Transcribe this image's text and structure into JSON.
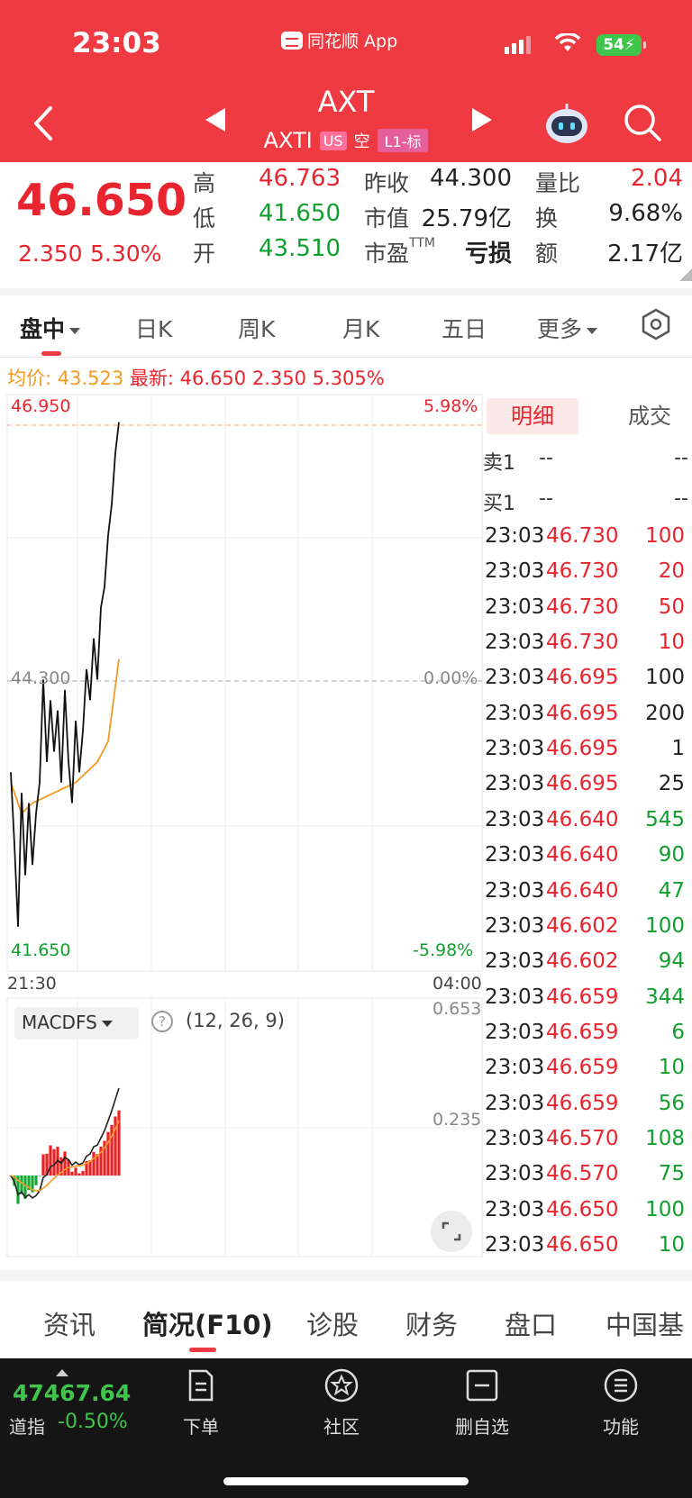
{
  "status": {
    "time": "23:03",
    "app_label": "同花顺 App",
    "battery": "54"
  },
  "header": {
    "symbol": "AXT",
    "sub_symbol": "AXTI",
    "tag_us": "US",
    "tag_short": "空",
    "tag_level": "L1-标"
  },
  "quote": {
    "price": "46.650",
    "change": "2.350",
    "change_pct": "5.30%",
    "rows": [
      {
        "l1": "高",
        "v1": "46.763",
        "l2": "昨收",
        "v2": "44.300",
        "l3": "量比",
        "v3": "2.04"
      },
      {
        "l1": "低",
        "v1": "41.650",
        "l2": "市值",
        "v2": "25.79亿",
        "l3": "换",
        "v3": "9.68%"
      },
      {
        "l1": "开",
        "v1": "43.510",
        "l2": "市盈",
        "l2_sup": "TTM",
        "v2": "亏损",
        "l3": "额",
        "v3": "2.17亿"
      }
    ]
  },
  "tabs": [
    "盘中",
    "日K",
    "周K",
    "月K",
    "五日",
    "更多"
  ],
  "infoline": {
    "avg_label": "均价: 43.523",
    "latest_label": "最新: 46.650",
    "change": "2.350",
    "pct": "5.305%"
  },
  "axis": {
    "top_price": "46.950",
    "top_pct": "5.98%",
    "mid_price": "44.300",
    "mid_pct": "0.00%",
    "bot_price": "41.650",
    "bot_pct": "-5.98%",
    "time_start": "21:30",
    "time_end": "04:00",
    "macd_top": "0.653",
    "macd_mid": "0.235"
  },
  "macd": {
    "indicator": "MACDFS",
    "help": "?",
    "params": "(12, 26, 9)"
  },
  "chart_data": {
    "type": "line",
    "title": "",
    "ylim": [
      41.65,
      46.95
    ],
    "series": [
      {
        "name": "最新",
        "x": [
          0,
          1,
          2,
          3,
          4,
          5,
          6,
          7,
          8,
          9,
          10,
          11,
          12,
          13,
          14,
          15,
          16,
          17,
          18,
          19,
          20,
          21,
          22,
          23,
          24,
          25,
          26,
          27,
          28,
          29,
          30
        ],
        "values": [
          43.3,
          42.6,
          41.8,
          43.1,
          42.3,
          43.0,
          42.4,
          42.9,
          43.2,
          44.2,
          43.4,
          44.0,
          43.5,
          43.9,
          43.2,
          44.1,
          43.4,
          43.0,
          43.8,
          43.3,
          43.7,
          44.3,
          44.0,
          44.6,
          44.2,
          44.9,
          45.1,
          45.6,
          45.9,
          46.4,
          46.7
        ]
      },
      {
        "name": "均价",
        "x": [
          0,
          3,
          6,
          9,
          12,
          15,
          18,
          21,
          24,
          27,
          30
        ],
        "values": [
          43.2,
          42.9,
          43.0,
          43.05,
          43.1,
          43.15,
          43.2,
          43.3,
          43.4,
          43.6,
          44.4
        ]
      }
    ]
  },
  "detail": {
    "tab_active": "明细",
    "tab_other": "成交",
    "orderbook": [
      {
        "label": "卖1",
        "price": "--",
        "vol": "--"
      },
      {
        "label": "买1",
        "price": "--",
        "vol": "--"
      }
    ],
    "trades": [
      {
        "time": "23:03",
        "price": "46.730",
        "vol": "100",
        "dir": "sell"
      },
      {
        "time": "23:03",
        "price": "46.730",
        "vol": "20",
        "dir": "sell"
      },
      {
        "time": "23:03",
        "price": "46.730",
        "vol": "50",
        "dir": "sell"
      },
      {
        "time": "23:03",
        "price": "46.730",
        "vol": "10",
        "dir": "sell"
      },
      {
        "time": "23:03",
        "price": "46.695",
        "vol": "100",
        "dir": "neutral"
      },
      {
        "time": "23:03",
        "price": "46.695",
        "vol": "200",
        "dir": "neutral"
      },
      {
        "time": "23:03",
        "price": "46.695",
        "vol": "1",
        "dir": "neutral"
      },
      {
        "time": "23:03",
        "price": "46.695",
        "vol": "25",
        "dir": "neutral"
      },
      {
        "time": "23:03",
        "price": "46.640",
        "vol": "545",
        "dir": "buy"
      },
      {
        "time": "23:03",
        "price": "46.640",
        "vol": "90",
        "dir": "buy"
      },
      {
        "time": "23:03",
        "price": "46.640",
        "vol": "47",
        "dir": "buy"
      },
      {
        "time": "23:03",
        "price": "46.602",
        "vol": "100",
        "dir": "buy"
      },
      {
        "time": "23:03",
        "price": "46.602",
        "vol": "94",
        "dir": "buy"
      },
      {
        "time": "23:03",
        "price": "46.659",
        "vol": "344",
        "dir": "buy"
      },
      {
        "time": "23:03",
        "price": "46.659",
        "vol": "6",
        "dir": "buy"
      },
      {
        "time": "23:03",
        "price": "46.659",
        "vol": "10",
        "dir": "buy"
      },
      {
        "time": "23:03",
        "price": "46.659",
        "vol": "56",
        "dir": "buy"
      },
      {
        "time": "23:03",
        "price": "46.570",
        "vol": "108",
        "dir": "buy"
      },
      {
        "time": "23:03",
        "price": "46.570",
        "vol": "75",
        "dir": "buy"
      },
      {
        "time": "23:03",
        "price": "46.650",
        "vol": "100",
        "dir": "buy"
      },
      {
        "time": "23:03",
        "price": "46.650",
        "vol": "10",
        "dir": "buy"
      }
    ]
  },
  "bottom_tabs": [
    "资讯",
    "简况(F10)",
    "诊股",
    "财务",
    "盘口",
    "中国基"
  ],
  "bottombar": {
    "index_value": "47467.64",
    "index_name": "道指",
    "index_change": "-0.50%",
    "items": [
      {
        "label": "下单",
        "icon": "order-icon"
      },
      {
        "label": "社区",
        "icon": "community-icon"
      },
      {
        "label": "删自选",
        "icon": "remove-watchlist-icon"
      },
      {
        "label": "功能",
        "icon": "menu-icon"
      }
    ]
  },
  "colors": {
    "brand_red": "#ef3a42",
    "up": "#e8242e",
    "down": "#10a02e",
    "avg_line": "#f29a25"
  }
}
